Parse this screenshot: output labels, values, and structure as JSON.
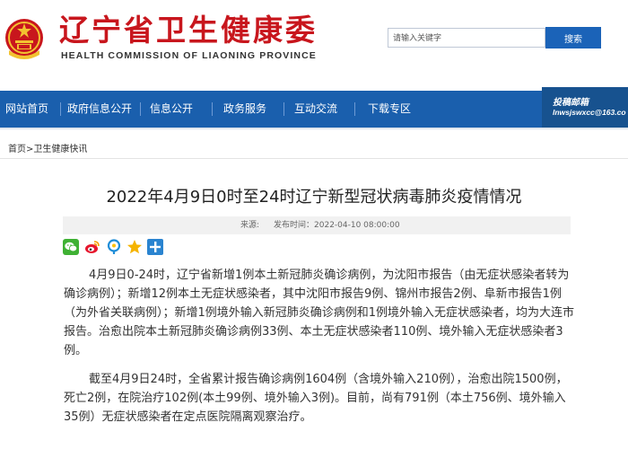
{
  "header": {
    "title": "辽宁省卫生健康委",
    "subtitle": "HEALTH COMMISSION OF LIAONING PROVINCE",
    "emblem_icon": "national-emblem-icon",
    "search": {
      "placeholder": "请输入关键字",
      "button_label": "搜索"
    }
  },
  "nav": {
    "items": [
      {
        "label": "网站首页"
      },
      {
        "label": "政府信息公开"
      },
      {
        "label": "信息公开"
      },
      {
        "label": "政务服务"
      },
      {
        "label": "互动交流"
      },
      {
        "label": "下载专区"
      }
    ],
    "mailbox": {
      "title": "投稿邮箱",
      "email": "lnwsjswxcc@163.co"
    }
  },
  "breadcrumb": {
    "home": "首页",
    "separator": ">",
    "section": "卫生健康快讯"
  },
  "article": {
    "title": "2022年4月9日0时至24时辽宁新型冠状病毒肺炎疫情情况",
    "source_label": "来源:",
    "date_label": "发布时间：",
    "date": "2022-04-10 08:00:00",
    "share_icons": [
      "wechat-icon",
      "weibo-icon",
      "qzone-icon",
      "favorite-star-icon",
      "plus-share-icon"
    ],
    "paragraphs": [
      "4月9日0-24时，辽宁省新增1例本土新冠肺炎确诊病例，为沈阳市报告（由无症状感染者转为确诊病例）；新增12例本土无症状感染者，其中沈阳市报告9例、锦州市报告2例、阜新市报告1例（为外省关联病例）；新增1例境外输入新冠肺炎确诊病例和1例境外输入无症状感染者，均为大连市报告。治愈出院本土新冠肺炎确诊病例33例、本土无症状感染者110例、境外输入无症状感染者3例。",
      "截至4月9日24时，全省累计报告确诊病例1604例（含境外输入210例），治愈出院1500例，死亡2例，在院治疗102例(本土99例、境外输入3例)。目前，尚有791例（本土756例、境外输入35例）无症状感染者在定点医院隔离观察治疗。"
    ]
  },
  "colors": {
    "brand_red": "#c8161d",
    "nav_blue": "#1a5fad",
    "button_blue": "#1b63b8"
  }
}
